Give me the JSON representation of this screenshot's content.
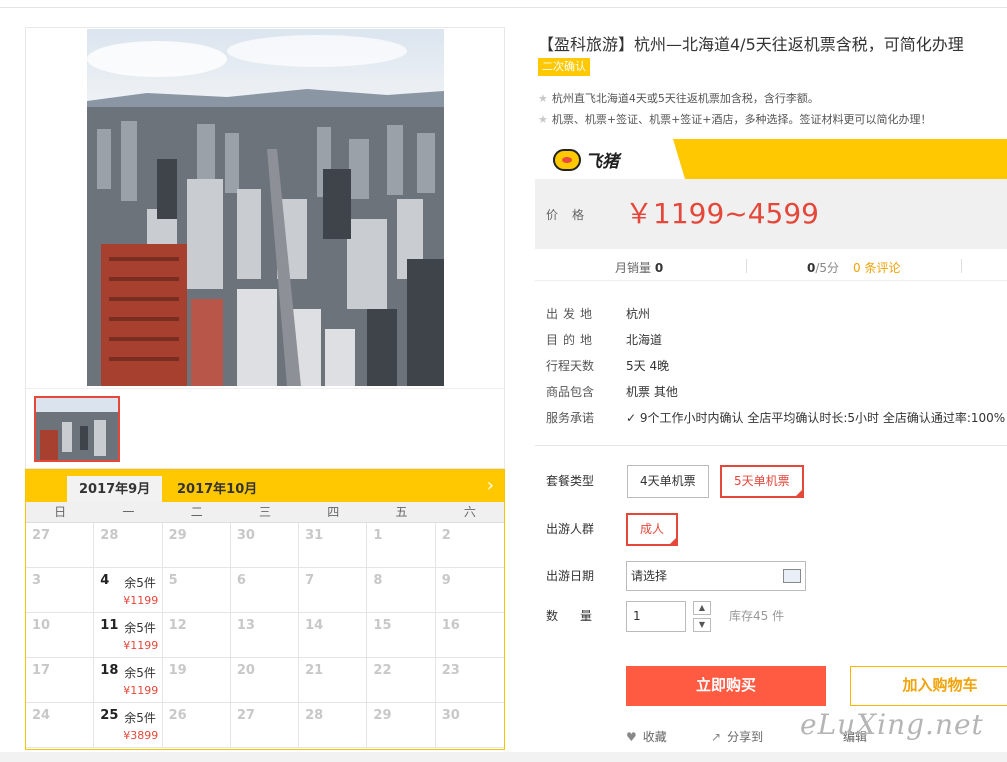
{
  "product": {
    "title": "【盈科旅游】杭州—北海道4/5天往返机票含税，可简化办理",
    "badge": "二次确认",
    "features": [
      "杭州直飞北海道4天或5天往返机票加含税，含行李额。",
      "机票、机票+签证、机票+签证+酒店，多种选择。签证材料更可以简化办理！"
    ]
  },
  "brand": {
    "name": "飞猪",
    "color": "#ffc800"
  },
  "price": {
    "label": "价格",
    "value": "￥1199~4599",
    "color": "#e4483b"
  },
  "stats": {
    "sales_label": "月销量",
    "sales_value": "0",
    "rating_value": "0",
    "rating_suffix": "/5分",
    "reviews": "0 条评论"
  },
  "details": [
    {
      "key": "出发地",
      "value": "杭州"
    },
    {
      "key": "目的地",
      "value": "北海道"
    },
    {
      "key": "行程天数",
      "value": "5天 4晚"
    },
    {
      "key": "商品包含",
      "value": "机票  其他"
    },
    {
      "key": "服务承诺",
      "value": "9个工作小时内确认    全店平均确认时长:5小时    全店确认通过率:100%"
    }
  ],
  "options": {
    "package_label": "套餐类型",
    "package_items": [
      "4天单机票",
      "5天单机票"
    ],
    "package_selected": 1,
    "crowd_label": "出游人群",
    "crowd_items": [
      "成人"
    ],
    "date_label": "出游日期",
    "date_placeholder": "请选择",
    "qty_label": "数量",
    "qty_value": "1",
    "stock": "库存45 件"
  },
  "buttons": {
    "buy": "立即购买",
    "cart": "加入购物车"
  },
  "footer": {
    "favorite": "收藏",
    "share": "分享到",
    "edit": "编辑"
  },
  "calendar": {
    "tabs": [
      "2017年9月",
      "2017年10月"
    ],
    "weekdays": [
      "日",
      "一",
      "二",
      "三",
      "四",
      "五",
      "六"
    ],
    "rows": [
      [
        {
          "d": "27"
        },
        {
          "d": "28"
        },
        {
          "d": "29"
        },
        {
          "d": "30"
        },
        {
          "d": "31"
        },
        {
          "d": "1"
        },
        {
          "d": "2"
        }
      ],
      [
        {
          "d": "3"
        },
        {
          "d": "4",
          "stock": "余5件",
          "price": "¥1199"
        },
        {
          "d": "5"
        },
        {
          "d": "6"
        },
        {
          "d": "7"
        },
        {
          "d": "8"
        },
        {
          "d": "9"
        }
      ],
      [
        {
          "d": "10"
        },
        {
          "d": "11",
          "stock": "余5件",
          "price": "¥1199"
        },
        {
          "d": "12"
        },
        {
          "d": "13"
        },
        {
          "d": "14"
        },
        {
          "d": "15"
        },
        {
          "d": "16"
        }
      ],
      [
        {
          "d": "17"
        },
        {
          "d": "18",
          "stock": "余5件",
          "price": "¥1199"
        },
        {
          "d": "19"
        },
        {
          "d": "20"
        },
        {
          "d": "21"
        },
        {
          "d": "22"
        },
        {
          "d": "23"
        }
      ],
      [
        {
          "d": "24"
        },
        {
          "d": "25",
          "stock": "余5件",
          "price": "¥3899"
        },
        {
          "d": "26"
        },
        {
          "d": "27"
        },
        {
          "d": "28"
        },
        {
          "d": "29"
        },
        {
          "d": "30"
        }
      ]
    ]
  },
  "watermark": "eLuXing.net"
}
